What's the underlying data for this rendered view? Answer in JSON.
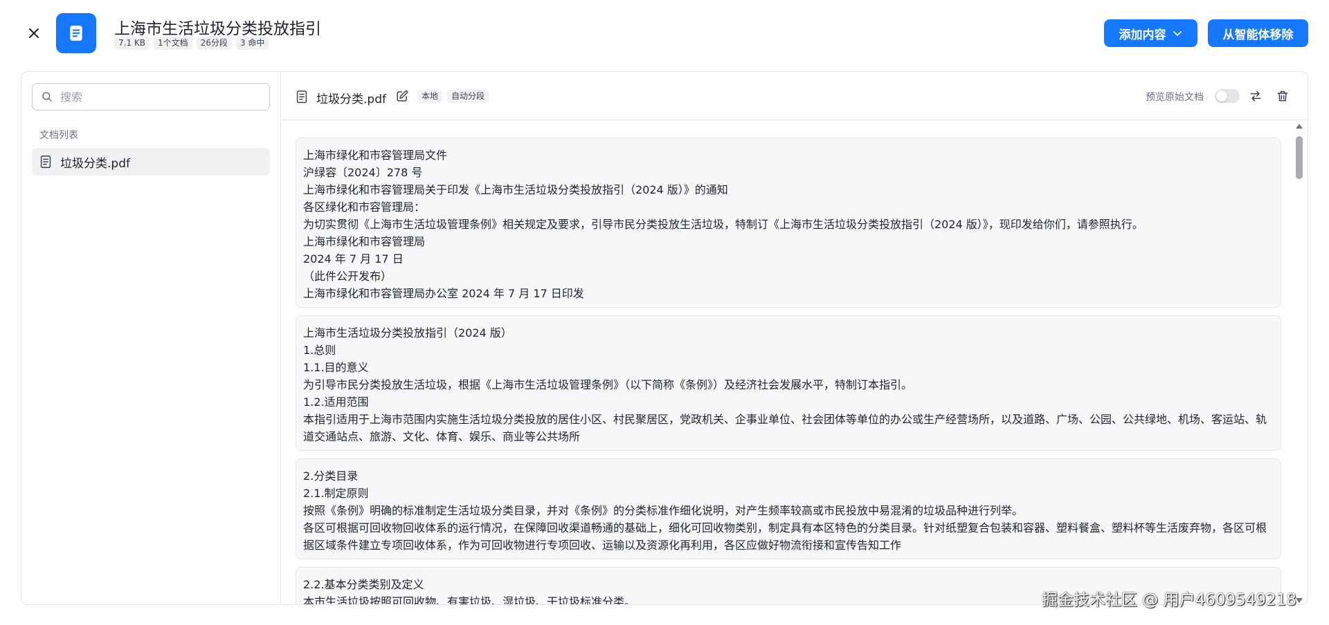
{
  "header": {
    "title": "上海市生活垃圾分类投放指引",
    "tags": [
      "7.1 KB",
      "1个文档",
      "26分段",
      "3 命中"
    ],
    "add_button": "添加内容",
    "remove_button": "从智能体移除"
  },
  "sidebar": {
    "search_placeholder": "搜索",
    "section_label": "文档列表",
    "documents": [
      {
        "name": "垃圾分类.pdf"
      }
    ]
  },
  "toolbar": {
    "doc_name": "垃圾分类.pdf",
    "tags": [
      "本地",
      "自动分段"
    ],
    "preview_label": "预览原始文档",
    "preview_enabled": false
  },
  "chunks": [
    {
      "lines": [
        "上海市绿化和市容管理局文件",
        "沪绿容〔2024〕278 号",
        "上海市绿化和市容管理局关于印发《上海市生活垃圾分类投放指引（2024 版）》的通知",
        "各区绿化和市容管理局：",
        "为切实贯彻《上海市生活垃圾管理条例》相关规定及要求，引导市民分类投放生活垃圾，特制订《上海市生活垃圾分类投放指引（2024 版）》，现印发给你们，请参照执行。",
        "上海市绿化和市容管理局",
        "2024 年 7 月 17 日",
        "（此件公开发布）",
        "上海市绿化和市容管理局办公室 2024 年 7 月 17 日印发"
      ]
    },
    {
      "lines": [
        "上海市生活垃圾分类投放指引（2024 版）",
        "1.总则",
        "1.1.目的意义",
        "为引导市民分类投放生活垃圾，根据《上海市生活垃圾管理条例》（以下简称《条例》）及经济社会发展水平，特制订本指引。",
        "1.2.适用范围",
        "本指引适用于上海市范围内实施生活垃圾分类投放的居住小区、村民聚居区，党政机关、企事业单位、社会团体等单位的办公或生产经营场所，以及道路、广场、公园、公共绿地、机场、客运站、轨道交通站点、旅游、文化、体育、娱乐、商业等公共场所"
      ]
    },
    {
      "lines": [
        "2.分类目录",
        "2.1.制定原则",
        "按照《条例》明确的标准制定生活垃圾分类目录，并对《条例》的分类标准作细化说明，对产生频率较高或市民投放中易混淆的垃圾品种进行列举。",
        "各区可根据可回收物回收体系的运行情况，在保障回收渠道畅通的基础上，细化可回收物类别，制定具有本区特色的分类目录。针对纸塑复合包装和容器、塑料餐盒、塑料杯等生活废弃物，各区可根据区域条件建立专项回收体系，作为可回收物进行专项回收、运输以及资源化再利用，各区应做好物流衔接和宣传告知工作"
      ]
    },
    {
      "lines": [
        "2.2.基本分类类别及定义",
        "本市生活垃圾按照可回收物、有害垃圾、湿垃圾、干垃圾标准分类。"
      ]
    }
  ],
  "watermark": "掘金技术社区 @ 用户4609549218"
}
